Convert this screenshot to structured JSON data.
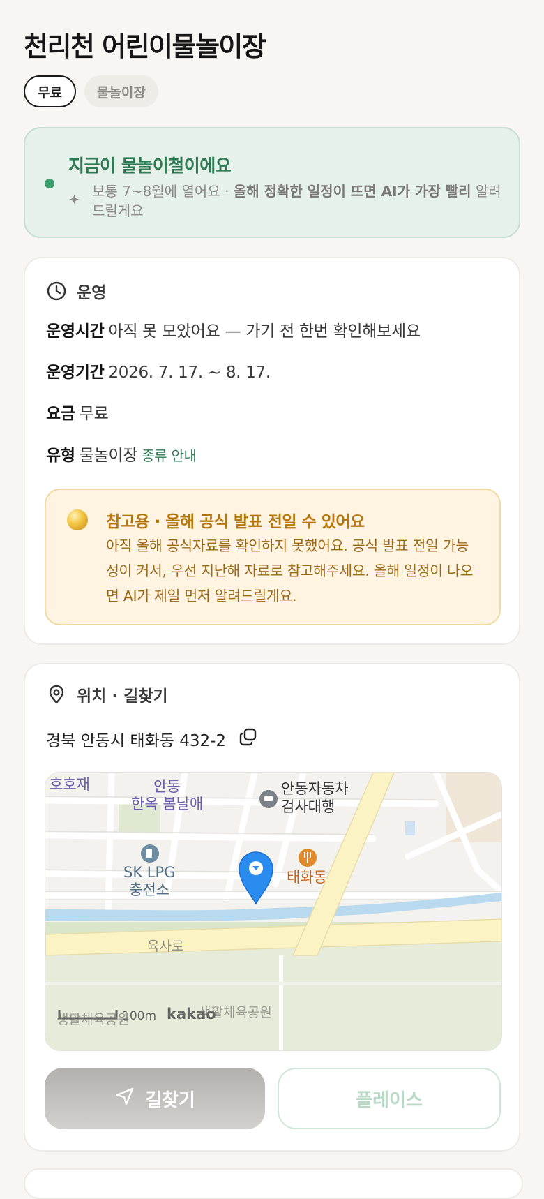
{
  "title": "천리천 어린이물놀이장",
  "tags": [
    {
      "label": "무료"
    },
    {
      "label": "물놀이장"
    }
  ],
  "season": {
    "heading": "지금이 물놀이철이에요",
    "sub_prefix": "보통 7~8월에 열어요 · ",
    "sub_bold": "올해 정확한 일정이 뜨면 AI가 가장 빨리",
    "sub_suffix": " 알려드릴게요"
  },
  "operation": {
    "heading": "운영",
    "rows": [
      {
        "key": "운영시간",
        "value": "아직 못 모았어요 — 가기 전 한번 확인해보세요"
      },
      {
        "key": "운영기간",
        "value": "2026. 7. 17. ~ 8. 17."
      },
      {
        "key": "요금",
        "value": "무료"
      },
      {
        "key": "유형",
        "value": "물놀이장",
        "link": "종류 안내"
      }
    ],
    "notice": {
      "heading": "참고용 · 올해 공식 발표 전일 수 있어요",
      "body": "아직 올해 공식자료를 확인하지 못했어요. 공식 발표 전일 가능성이 커서, 우선 지난해 자료로 참고해주세요. 올해 일정이 나오면 AI가 제일 먼저 알려드릴게요."
    }
  },
  "location": {
    "heading": "위치 · 길찾기",
    "address": "경북 안동시 태화동 432-2",
    "map": {
      "labels": {
        "hohojae": "호호재",
        "andong1": "안동",
        "andong2": "한옥 봄날애",
        "inspect1": "안동자동차",
        "inspect2": "검사대행",
        "sk1": "SK LPG",
        "sk2": "충전소",
        "taehwa": "태화동",
        "yuksa": "육사로",
        "park1": "생활체육공원",
        "park2": "생활체육공원",
        "scale": "100m",
        "brand": "kakao"
      }
    },
    "route_label": "길찾기",
    "place_label": "플레이스"
  },
  "colors": {
    "accent_green": "#2d7a54",
    "notice_orange": "#b5770e",
    "map_pin": "#2b8cf0"
  }
}
